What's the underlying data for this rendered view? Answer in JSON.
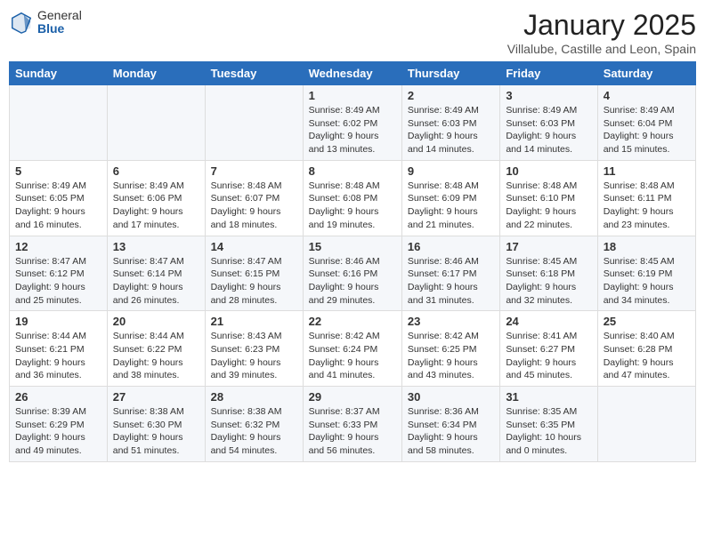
{
  "logo": {
    "general": "General",
    "blue": "Blue"
  },
  "header": {
    "month": "January 2025",
    "location": "Villalube, Castille and Leon, Spain"
  },
  "weekdays": [
    "Sunday",
    "Monday",
    "Tuesday",
    "Wednesday",
    "Thursday",
    "Friday",
    "Saturday"
  ],
  "weeks": [
    [
      {
        "day": "",
        "info": ""
      },
      {
        "day": "",
        "info": ""
      },
      {
        "day": "",
        "info": ""
      },
      {
        "day": "1",
        "info": "Sunrise: 8:49 AM\nSunset: 6:02 PM\nDaylight: 9 hours\nand 13 minutes."
      },
      {
        "day": "2",
        "info": "Sunrise: 8:49 AM\nSunset: 6:03 PM\nDaylight: 9 hours\nand 14 minutes."
      },
      {
        "day": "3",
        "info": "Sunrise: 8:49 AM\nSunset: 6:03 PM\nDaylight: 9 hours\nand 14 minutes."
      },
      {
        "day": "4",
        "info": "Sunrise: 8:49 AM\nSunset: 6:04 PM\nDaylight: 9 hours\nand 15 minutes."
      }
    ],
    [
      {
        "day": "5",
        "info": "Sunrise: 8:49 AM\nSunset: 6:05 PM\nDaylight: 9 hours\nand 16 minutes."
      },
      {
        "day": "6",
        "info": "Sunrise: 8:49 AM\nSunset: 6:06 PM\nDaylight: 9 hours\nand 17 minutes."
      },
      {
        "day": "7",
        "info": "Sunrise: 8:48 AM\nSunset: 6:07 PM\nDaylight: 9 hours\nand 18 minutes."
      },
      {
        "day": "8",
        "info": "Sunrise: 8:48 AM\nSunset: 6:08 PM\nDaylight: 9 hours\nand 19 minutes."
      },
      {
        "day": "9",
        "info": "Sunrise: 8:48 AM\nSunset: 6:09 PM\nDaylight: 9 hours\nand 21 minutes."
      },
      {
        "day": "10",
        "info": "Sunrise: 8:48 AM\nSunset: 6:10 PM\nDaylight: 9 hours\nand 22 minutes."
      },
      {
        "day": "11",
        "info": "Sunrise: 8:48 AM\nSunset: 6:11 PM\nDaylight: 9 hours\nand 23 minutes."
      }
    ],
    [
      {
        "day": "12",
        "info": "Sunrise: 8:47 AM\nSunset: 6:12 PM\nDaylight: 9 hours\nand 25 minutes."
      },
      {
        "day": "13",
        "info": "Sunrise: 8:47 AM\nSunset: 6:14 PM\nDaylight: 9 hours\nand 26 minutes."
      },
      {
        "day": "14",
        "info": "Sunrise: 8:47 AM\nSunset: 6:15 PM\nDaylight: 9 hours\nand 28 minutes."
      },
      {
        "day": "15",
        "info": "Sunrise: 8:46 AM\nSunset: 6:16 PM\nDaylight: 9 hours\nand 29 minutes."
      },
      {
        "day": "16",
        "info": "Sunrise: 8:46 AM\nSunset: 6:17 PM\nDaylight: 9 hours\nand 31 minutes."
      },
      {
        "day": "17",
        "info": "Sunrise: 8:45 AM\nSunset: 6:18 PM\nDaylight: 9 hours\nand 32 minutes."
      },
      {
        "day": "18",
        "info": "Sunrise: 8:45 AM\nSunset: 6:19 PM\nDaylight: 9 hours\nand 34 minutes."
      }
    ],
    [
      {
        "day": "19",
        "info": "Sunrise: 8:44 AM\nSunset: 6:21 PM\nDaylight: 9 hours\nand 36 minutes."
      },
      {
        "day": "20",
        "info": "Sunrise: 8:44 AM\nSunset: 6:22 PM\nDaylight: 9 hours\nand 38 minutes."
      },
      {
        "day": "21",
        "info": "Sunrise: 8:43 AM\nSunset: 6:23 PM\nDaylight: 9 hours\nand 39 minutes."
      },
      {
        "day": "22",
        "info": "Sunrise: 8:42 AM\nSunset: 6:24 PM\nDaylight: 9 hours\nand 41 minutes."
      },
      {
        "day": "23",
        "info": "Sunrise: 8:42 AM\nSunset: 6:25 PM\nDaylight: 9 hours\nand 43 minutes."
      },
      {
        "day": "24",
        "info": "Sunrise: 8:41 AM\nSunset: 6:27 PM\nDaylight: 9 hours\nand 45 minutes."
      },
      {
        "day": "25",
        "info": "Sunrise: 8:40 AM\nSunset: 6:28 PM\nDaylight: 9 hours\nand 47 minutes."
      }
    ],
    [
      {
        "day": "26",
        "info": "Sunrise: 8:39 AM\nSunset: 6:29 PM\nDaylight: 9 hours\nand 49 minutes."
      },
      {
        "day": "27",
        "info": "Sunrise: 8:38 AM\nSunset: 6:30 PM\nDaylight: 9 hours\nand 51 minutes."
      },
      {
        "day": "28",
        "info": "Sunrise: 8:38 AM\nSunset: 6:32 PM\nDaylight: 9 hours\nand 54 minutes."
      },
      {
        "day": "29",
        "info": "Sunrise: 8:37 AM\nSunset: 6:33 PM\nDaylight: 9 hours\nand 56 minutes."
      },
      {
        "day": "30",
        "info": "Sunrise: 8:36 AM\nSunset: 6:34 PM\nDaylight: 9 hours\nand 58 minutes."
      },
      {
        "day": "31",
        "info": "Sunrise: 8:35 AM\nSunset: 6:35 PM\nDaylight: 10 hours\nand 0 minutes."
      },
      {
        "day": "",
        "info": ""
      }
    ]
  ]
}
